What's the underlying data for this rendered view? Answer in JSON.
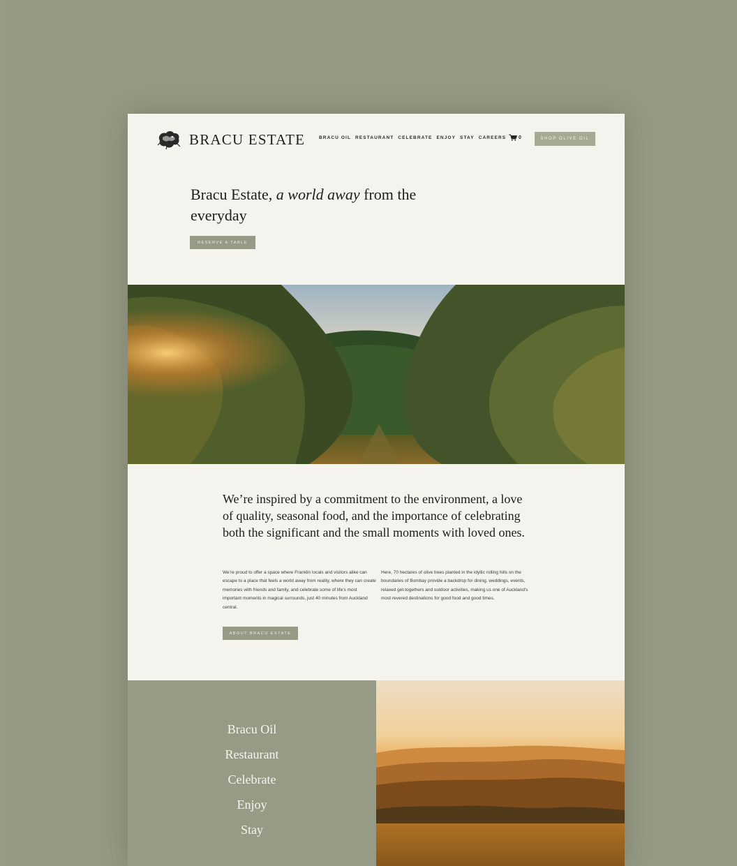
{
  "brand": {
    "name": "BRACU ESTATE",
    "logo_icon": "dragon-logo-icon"
  },
  "nav": {
    "items": [
      "BRACU OIL",
      "RESTAURANT",
      "CELEBRATE",
      "ENJOY",
      "STAY",
      "CAREERS"
    ],
    "cart_icon": "cart-icon",
    "cart_count": "0",
    "shop_label": "SHOP OLIVE OIL"
  },
  "hero": {
    "title_start": "Bracu Estate, ",
    "title_italic": "a world away",
    "title_end": " from the everyday",
    "cta_label": "RESERVE A TABLE"
  },
  "intro": {
    "lead": "We’re inspired by a commitment to the environment, a love of quality, seasonal food, and the importance of celebrating both the significant and the small moments with loved ones.",
    "col1": "We’re proud to offer a space where Franklin locals and visitors alike can escape to a place that feels a world away from reality, where they can create memories with friends and family, and celebrate some of life’s most important moments in magical surrounds, just 40 minutes from Auckland central.",
    "col2": "Here, 70 hectares of olive trees planted in the idyllic rolling hills on the boundaries of Bombay provide a backdrop for dining, weddings, events, relaxed get-togethers and outdoor activities, making us one of Auckland’s most revered destinations for good food and good times.",
    "cta_label": "ABOUT BRACU ESTATE"
  },
  "bottom_nav": {
    "items": [
      "Bracu Oil",
      "Restaurant",
      "Celebrate",
      "Enjoy",
      "Stay"
    ]
  },
  "colors": {
    "background": "#979b85",
    "page": "#f5f3ee",
    "accent": "#a6aa92"
  }
}
